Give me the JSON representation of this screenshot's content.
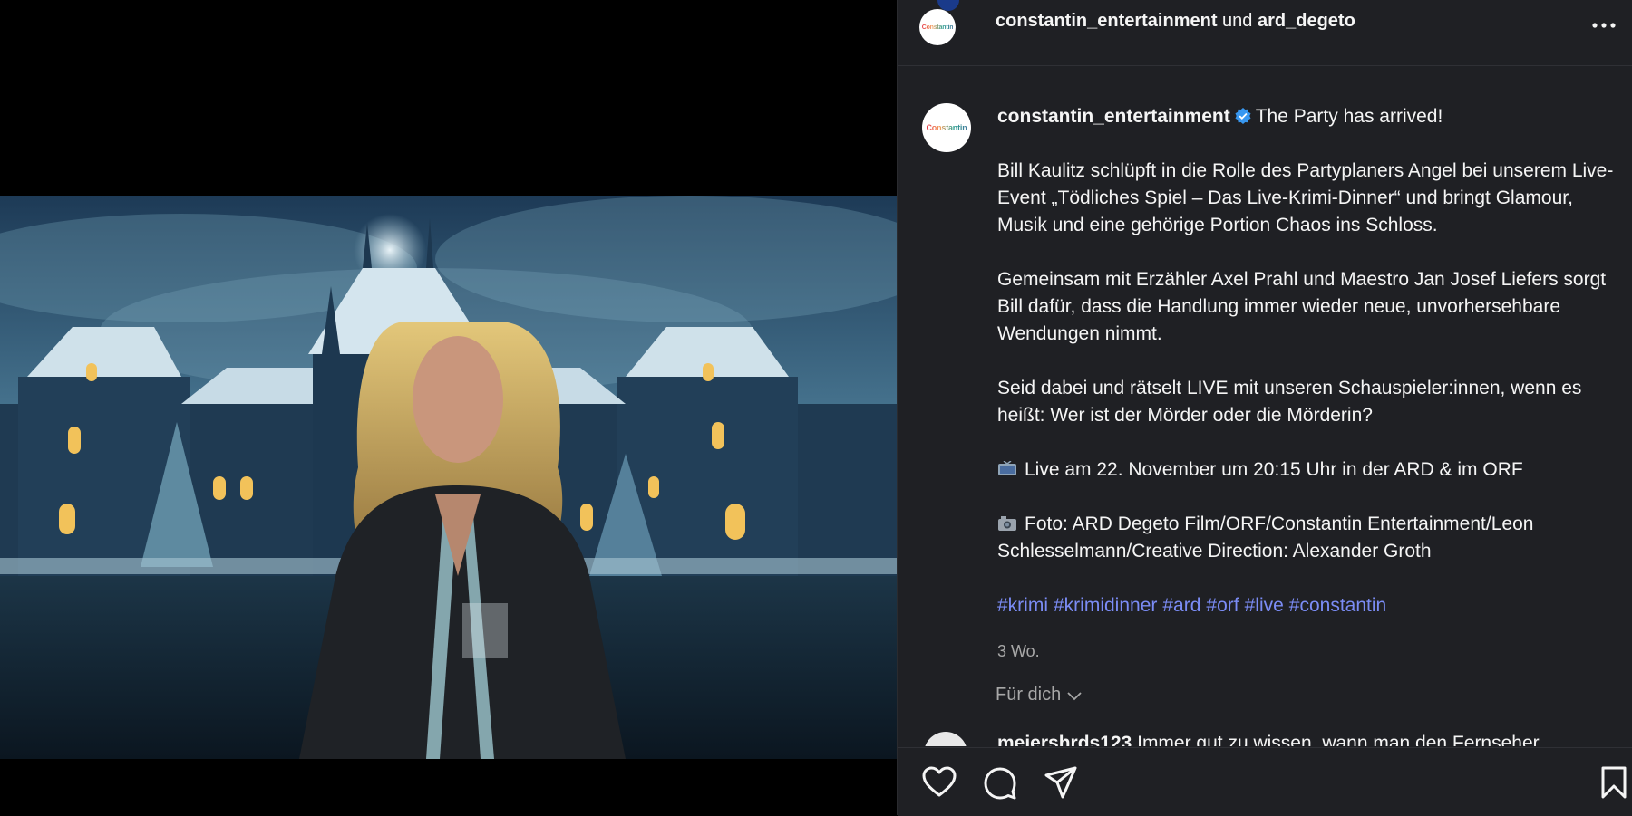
{
  "header": {
    "account1": "constantin_entertainment",
    "joiner": "und",
    "account2": "ard_degeto",
    "avatar_logo": "Constantin"
  },
  "post": {
    "username": "constantin_entertainment",
    "headline": "The Party has arrived!",
    "paragraph1": "Bill Kaulitz schlüpft in die Rolle des Partyplaners Angel bei unserem Live-Event „Tödliches Spiel – Das Live-Krimi-Dinner“ und bringt Glamour, Musik und eine gehörige Portion Chaos ins Schloss.",
    "paragraph2": "Gemeinsam mit Erzähler Axel Prahl und Maestro Jan Josef Liefers sorgt Bill dafür, dass die Handlung immer wieder neue, unvorhersehbare Wendungen nimmt.",
    "paragraph3": "Seid dabei und rätselt LIVE mit unseren Schauspieler:innen, wenn es heißt: Wer ist der Mörder oder die Mörderin?",
    "live_line": "Live am 22. November um 20:15 Uhr in der ARD & im ORF",
    "photo_line": "Foto: ARD Degeto Film/ORF/Constantin Entertainment/Leon Schlesselmann/Creative Direction: Alexander Groth",
    "hashtags": [
      "#krimi",
      "#krimidinner",
      "#ard",
      "#orf",
      "#live",
      "#constantin"
    ],
    "timestamp": "3 Wo.",
    "avatar_logo": "Constantin"
  },
  "filter": {
    "label": "Für dich"
  },
  "comment_peek": {
    "username": "meiershrds123",
    "text": "Immer gut zu wissen, wann man den Fernseher"
  },
  "icons": {
    "like": "heart-icon",
    "comment": "comment-icon",
    "share": "send-icon",
    "save": "bookmark-icon",
    "more": "more-icon",
    "verified": "verified-icon"
  },
  "colors": {
    "panel_bg": "#1f2024",
    "hashtag": "#7b8cf5",
    "verified": "#3897f0",
    "muted": "#a8a8a8"
  }
}
